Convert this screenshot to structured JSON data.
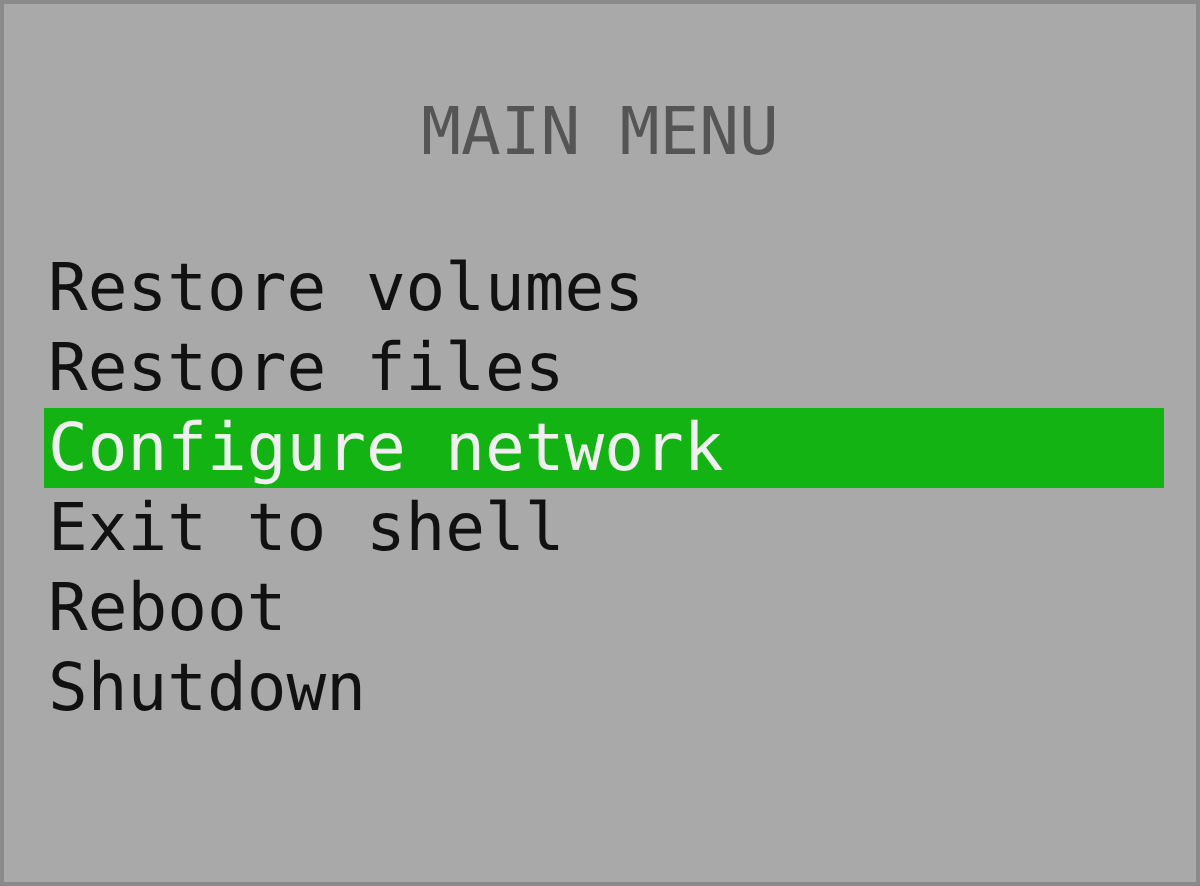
{
  "title": "MAIN MENU",
  "items": [
    {
      "label": "Restore volumes",
      "selected": false
    },
    {
      "label": "Restore files",
      "selected": false
    },
    {
      "label": "Configure network",
      "selected": true
    },
    {
      "label": "Exit to shell",
      "selected": false
    },
    {
      "label": "Reboot",
      "selected": false
    },
    {
      "label": "Shutdown",
      "selected": false
    }
  ]
}
